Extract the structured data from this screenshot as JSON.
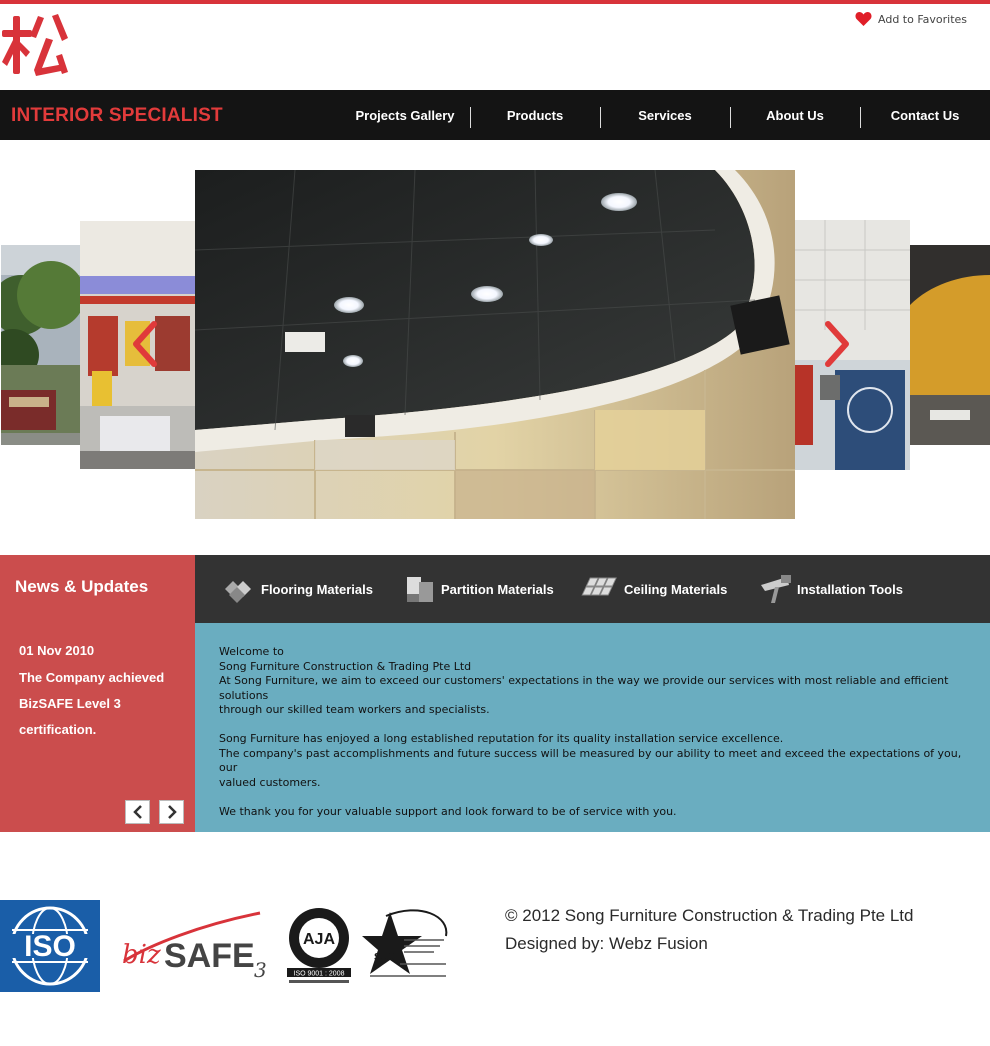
{
  "header": {
    "logo_char": "松",
    "favorites_label": "Add to Favorites",
    "tagline": "INTERIOR SPECIALIST"
  },
  "nav": {
    "items": [
      {
        "label": "Projects Gallery"
      },
      {
        "label": "Products"
      },
      {
        "label": "Services"
      },
      {
        "label": "About Us"
      },
      {
        "label": "Contact Us"
      }
    ]
  },
  "news": {
    "title": "News & Updates",
    "date": "01 Nov 2010",
    "text": "The Company achieved BizSAFE Level 3 certification."
  },
  "categories": [
    {
      "label": "Flooring Materials",
      "icon": "flooring-icon"
    },
    {
      "label": "Partition Materials",
      "icon": "partition-icon"
    },
    {
      "label": "Ceiling Materials",
      "icon": "ceiling-icon"
    },
    {
      "label": "Installation Tools",
      "icon": "tools-icon"
    }
  ],
  "welcome": {
    "line1": "Welcome to",
    "line2": "Song Furniture Construction & Trading Pte Ltd",
    "line3": "At Song Furniture, we aim to exceed our customers' expectations in the way we provide our services with most reliable and efficient solutions\nthrough our skilled team workers and specialists.",
    "line4": "Song Furniture has enjoyed a long established reputation for its quality installation service excellence.",
    "line5": "The company's past accomplishments and future success will be measured by our ability to meet and exceed the expectations of you, our\n valued customers.",
    "line6": "We thank you for your valuable support and look forward to be of service with you."
  },
  "certs": {
    "iso_text": "ISO",
    "bizsafe_text": "bizSAFE",
    "bizsafe_level": "3",
    "anab_text": "AJA",
    "anab_std": "ISO 9001 : 2008",
    "sac_text": "SAC"
  },
  "footer": {
    "copyright": "© 2012 Song Furniture Construction & Trading Pte Ltd",
    "designer": "Designed by: Webz Fusion"
  },
  "colors": {
    "accent": "#d8333a",
    "news_bg": "#cb4d4d",
    "welcome_bg": "#6aadc0",
    "nav_bg": "#141414",
    "cat_bg": "#333333"
  }
}
